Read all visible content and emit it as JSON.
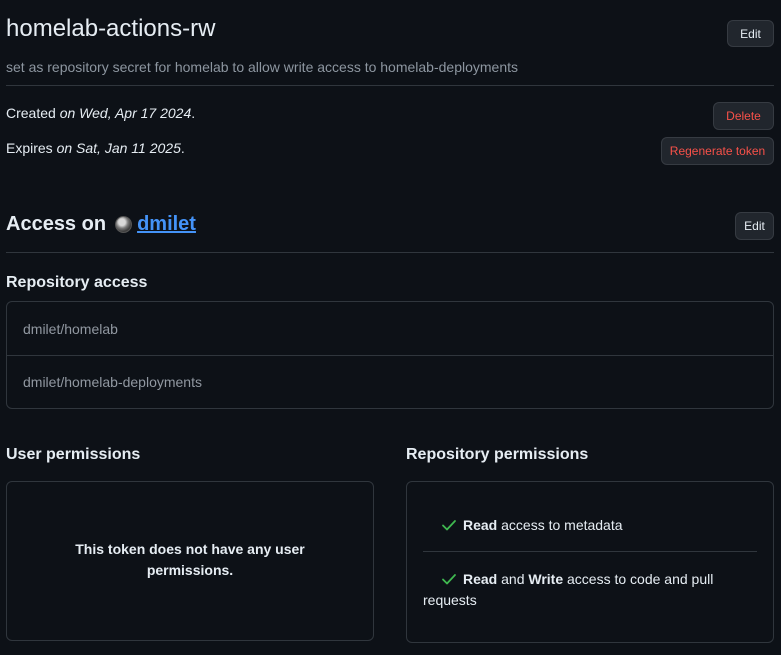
{
  "token": {
    "name": "homelab-actions-rw",
    "description": "set as repository secret for homelab to allow write access to homelab-deployments",
    "edit_label": "Edit",
    "created_prefix": "Created ",
    "created_date": "on Wed, Apr 17 2024",
    "expires_prefix": "Expires ",
    "expires_date": "on Sat, Jan 11 2025",
    "period": ".",
    "delete_label": "Delete",
    "regenerate_label": "Regenerate token"
  },
  "access": {
    "title_prefix": "Access on",
    "owner": "dmilet",
    "edit_label": "Edit"
  },
  "repository_access": {
    "heading": "Repository access",
    "repos": [
      "dmilet/homelab",
      "dmilet/homelab-deployments"
    ]
  },
  "user_permissions": {
    "heading": "User permissions",
    "empty_message": "This token does not have any user permissions."
  },
  "repository_permissions": {
    "heading": "Repository permissions",
    "items": [
      {
        "strong1": "Read",
        "text1": " access to metadata",
        "strong2": "",
        "text2": ""
      },
      {
        "strong1": "Read",
        "text1": " and ",
        "strong2": "Write",
        "text2": " access to code and pull requests"
      }
    ]
  },
  "colors": {
    "background": "#0d1117",
    "link": "#4493f8",
    "danger": "#f85149",
    "success": "#3fb950"
  },
  "icons": [
    "check-icon",
    "avatar"
  ]
}
